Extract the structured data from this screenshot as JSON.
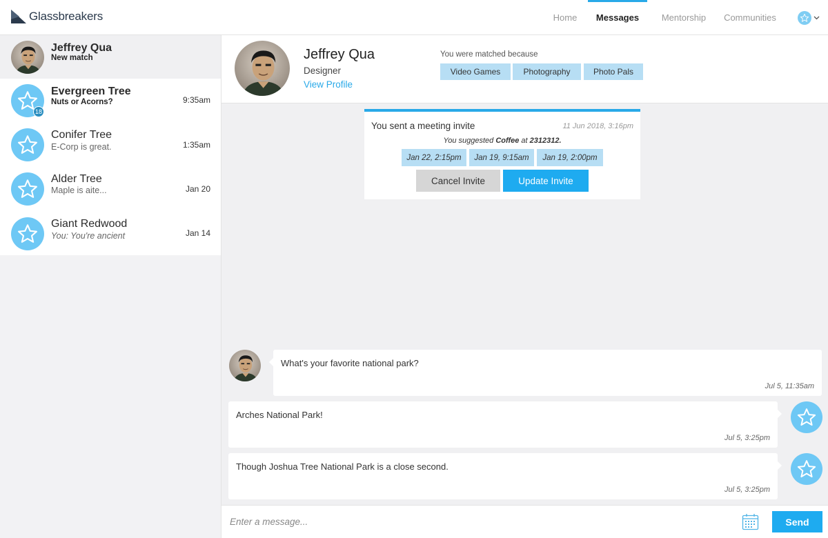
{
  "app": {
    "name": "Glassbreakers"
  },
  "nav": {
    "home": "Home",
    "messages": "Messages",
    "mentorship": "Mentorship",
    "communities": "Communities"
  },
  "conversations": [
    {
      "name": "Jeffrey Qua",
      "preview": "New match",
      "time": ""
    },
    {
      "name": "Evergreen Tree",
      "preview": "Nuts or Acorns?",
      "time": "9:35am",
      "badge": "18"
    },
    {
      "name": "Conifer Tree",
      "preview": "E-Corp is great.",
      "time": "1:35am"
    },
    {
      "name": "Alder Tree",
      "preview": "Maple is aite...",
      "time": "Jan 20"
    },
    {
      "name": "Giant Redwood",
      "preview": "You: You're ancient",
      "time": "Jan 14"
    }
  ],
  "profile": {
    "name": "Jeffrey Qua",
    "role": "Designer",
    "link": "View Profile",
    "matched_label": "You were matched because",
    "tags": [
      "Video Games",
      "Photography",
      "Photo Pals"
    ]
  },
  "invite": {
    "title": "You sent a meeting invite",
    "date": "11 Jun 2018, 3:16pm",
    "suggest_prefix": "You suggested ",
    "suggest_item": "Coffee",
    "suggest_mid": " at ",
    "suggest_place": "2312312.",
    "slots": [
      "Jan 22, 2:15pm",
      "Jan 19, 9:15am",
      "Jan 19, 2:00pm"
    ],
    "cancel": "Cancel Invite",
    "update": "Update Invite"
  },
  "messages": [
    {
      "text": "What's your favorite national park?",
      "time": "Jul 5, 11:35am",
      "from": "them"
    },
    {
      "text": "Arches National Park!",
      "time": "Jul 5, 3:25pm",
      "from": "me"
    },
    {
      "text": "Though Joshua Tree National Park is a close second.",
      "time": "Jul 5, 3:25pm",
      "from": "me"
    }
  ],
  "composer": {
    "placeholder": "Enter a message...",
    "send": "Send"
  },
  "colors": {
    "accent": "#1eabf0",
    "tag": "#b7def4",
    "avatar": "#6ec8f5"
  }
}
